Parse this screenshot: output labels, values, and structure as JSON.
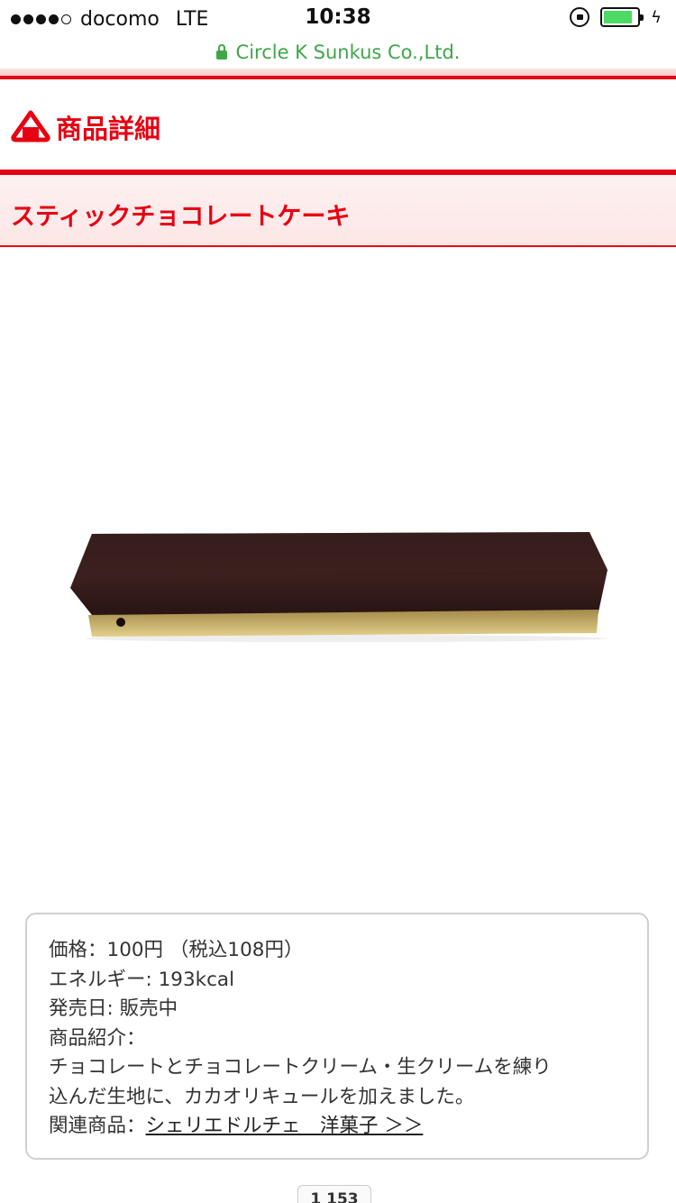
{
  "status_bar": {
    "carrier": "docomo",
    "network": "LTE",
    "time": "10:38",
    "battery_level": 0.85
  },
  "url_bar": {
    "site": "Circle K Sunkus Co.,Ltd."
  },
  "header": {
    "title": "商品詳細"
  },
  "product": {
    "name": "スティックチョコレートケーキ"
  },
  "details": {
    "price_label": "価格：",
    "price": "100円",
    "price_tax": "（税込108円）",
    "energy_label": "エネルギー: ",
    "energy": "193kcal",
    "release_label": "発売日: ",
    "release": "販売中",
    "intro_label": "商品紹介：",
    "intro_line1": "チョコレートとチョコレートクリーム・生クリームを練り",
    "intro_line2": "込んだ生地に、カカオリキュールを加えました。",
    "related_label": "関連商品：",
    "related_link": "シェリエドルチェ　洋菓子 ＞＞"
  },
  "pager": {
    "text": "1 153"
  },
  "colors": {
    "brand_red": "#e60012",
    "url_green": "#3fa64a"
  }
}
